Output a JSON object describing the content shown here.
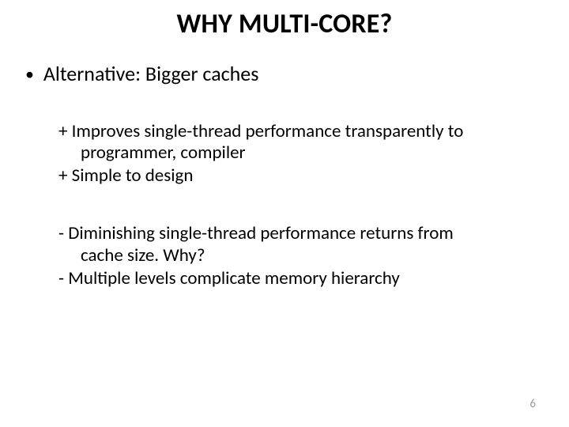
{
  "title": "WHY MULTI-CORE?",
  "bullet": {
    "label": "Alternative: Bigger caches"
  },
  "pros": {
    "line1a": "+ Improves single-thread performance transparently to",
    "line1b": "programmer, compiler",
    "line2": "+ Simple to design"
  },
  "cons": {
    "line1a": "- Diminishing single-thread performance returns from",
    "line1b": "cache size. Why?",
    "line2": "- Multiple levels complicate memory hierarchy"
  },
  "page_number": "6"
}
